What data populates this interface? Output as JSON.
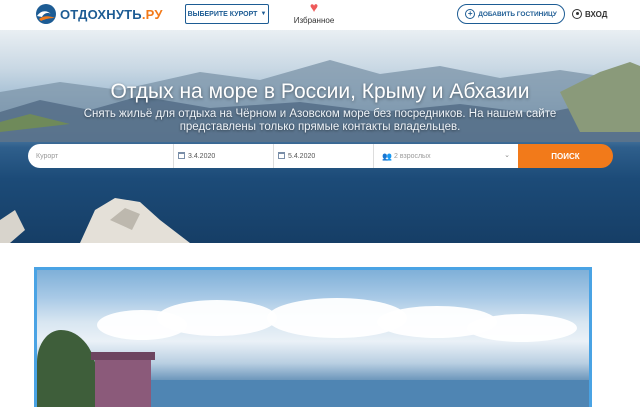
{
  "header": {
    "logo_text": "ОТДОХНУТЬ",
    "logo_suffix": ".РУ",
    "resort_button": "ВЫБЕРИТЕ КУРОРТ",
    "favorites_label": "Избранное",
    "add_hotel_button": "ДОБАВИТЬ ГОСТИНИЦУ",
    "login_label": "ВХОД"
  },
  "hero": {
    "title": "Отдых на море в России, Крыму и Абхазии",
    "subtitle": "Снять жильё для отдыха на Чёрном и Азовском море без посредников. На нашем сайте представлены только прямые контакты владельцев."
  },
  "search": {
    "resort_placeholder": "Курорт",
    "checkin_value": "3.4.2020",
    "checkout_value": "5.4.2020",
    "guests_value": "2 взрослых",
    "search_button": "ПОИСК"
  },
  "colors": {
    "brand_blue": "#1d5c94",
    "accent_orange": "#f27a1a",
    "card_border": "#4aa3e4",
    "heart": "#ee5a5a"
  },
  "icons": {
    "logo": "wave-logo-icon",
    "resort_caret": "chevron-down-icon",
    "favorites": "heart-icon",
    "add_hotel": "plus-circle-icon",
    "login": "user-icon",
    "checkin": "calendar-icon",
    "checkout": "calendar-icon",
    "guests": "users-icon",
    "guests_caret": "chevron-down-icon"
  }
}
